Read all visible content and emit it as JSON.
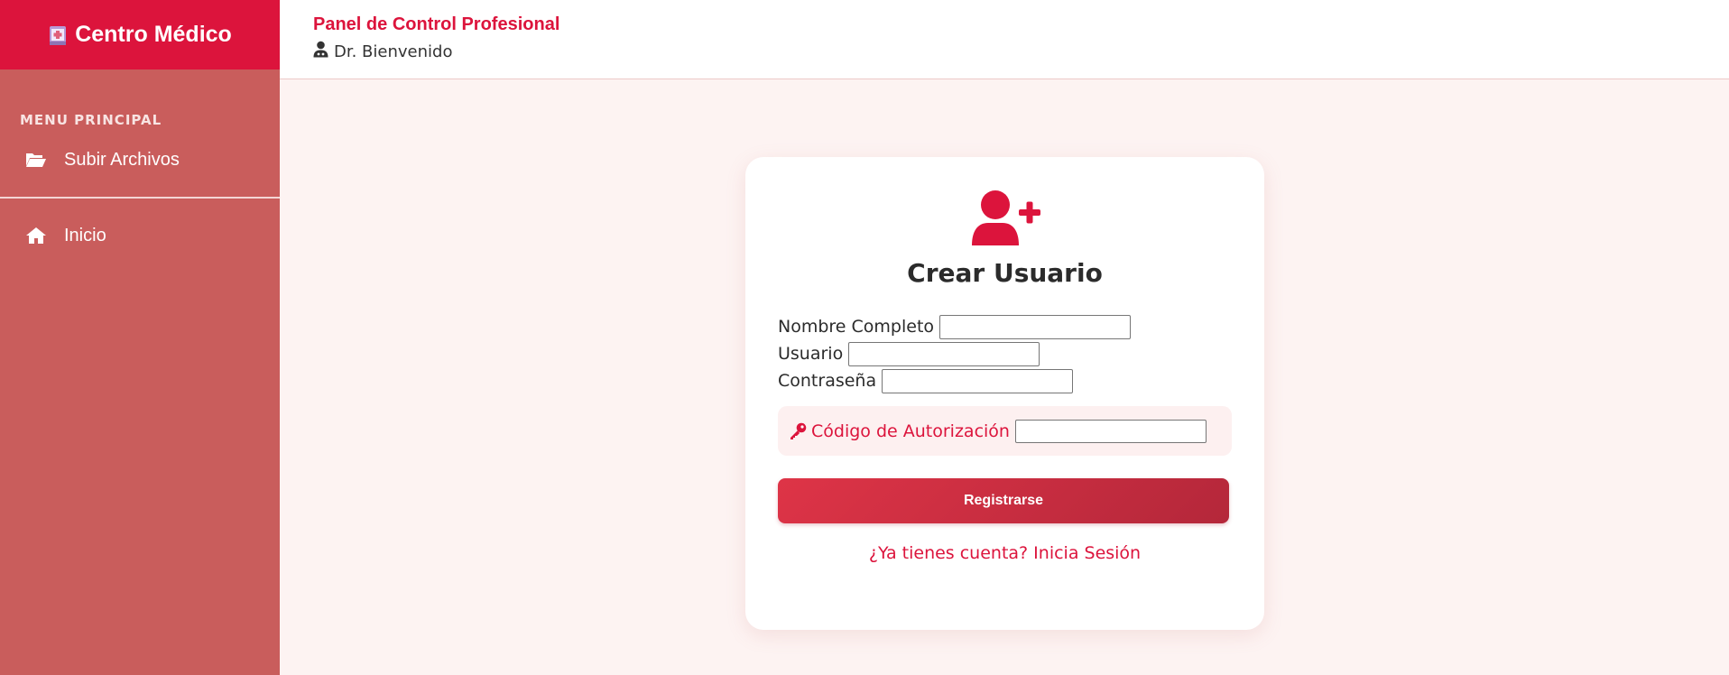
{
  "sidebar": {
    "brand": "Centro Médico",
    "menu_heading": "MENU PRINCIPAL",
    "items": [
      {
        "label": "Subir Archivos",
        "icon": "folder-open-icon"
      },
      {
        "label": "Inicio",
        "icon": "home-icon"
      }
    ]
  },
  "header": {
    "title": "Panel de Control Profesional",
    "user": "Dr. Bienvenido",
    "user_icon": "doctor-icon"
  },
  "card": {
    "icon": "user-plus-icon",
    "title": "Crear Usuario",
    "fields": {
      "full_name_label": "Nombre Completo",
      "full_name_value": "",
      "username_label": "Usuario",
      "username_value": "",
      "password_label": "Contraseña",
      "password_value": ""
    },
    "auth": {
      "icon": "key-icon",
      "label": "Código de Autorización",
      "value": ""
    },
    "submit_label": "Registrarse",
    "login_link": "¿Ya tienes cuenta? Inicia Sesión"
  },
  "colors": {
    "brand": "#dc143c",
    "sidebar": "#c95d5c",
    "background": "#fdf3f2"
  }
}
